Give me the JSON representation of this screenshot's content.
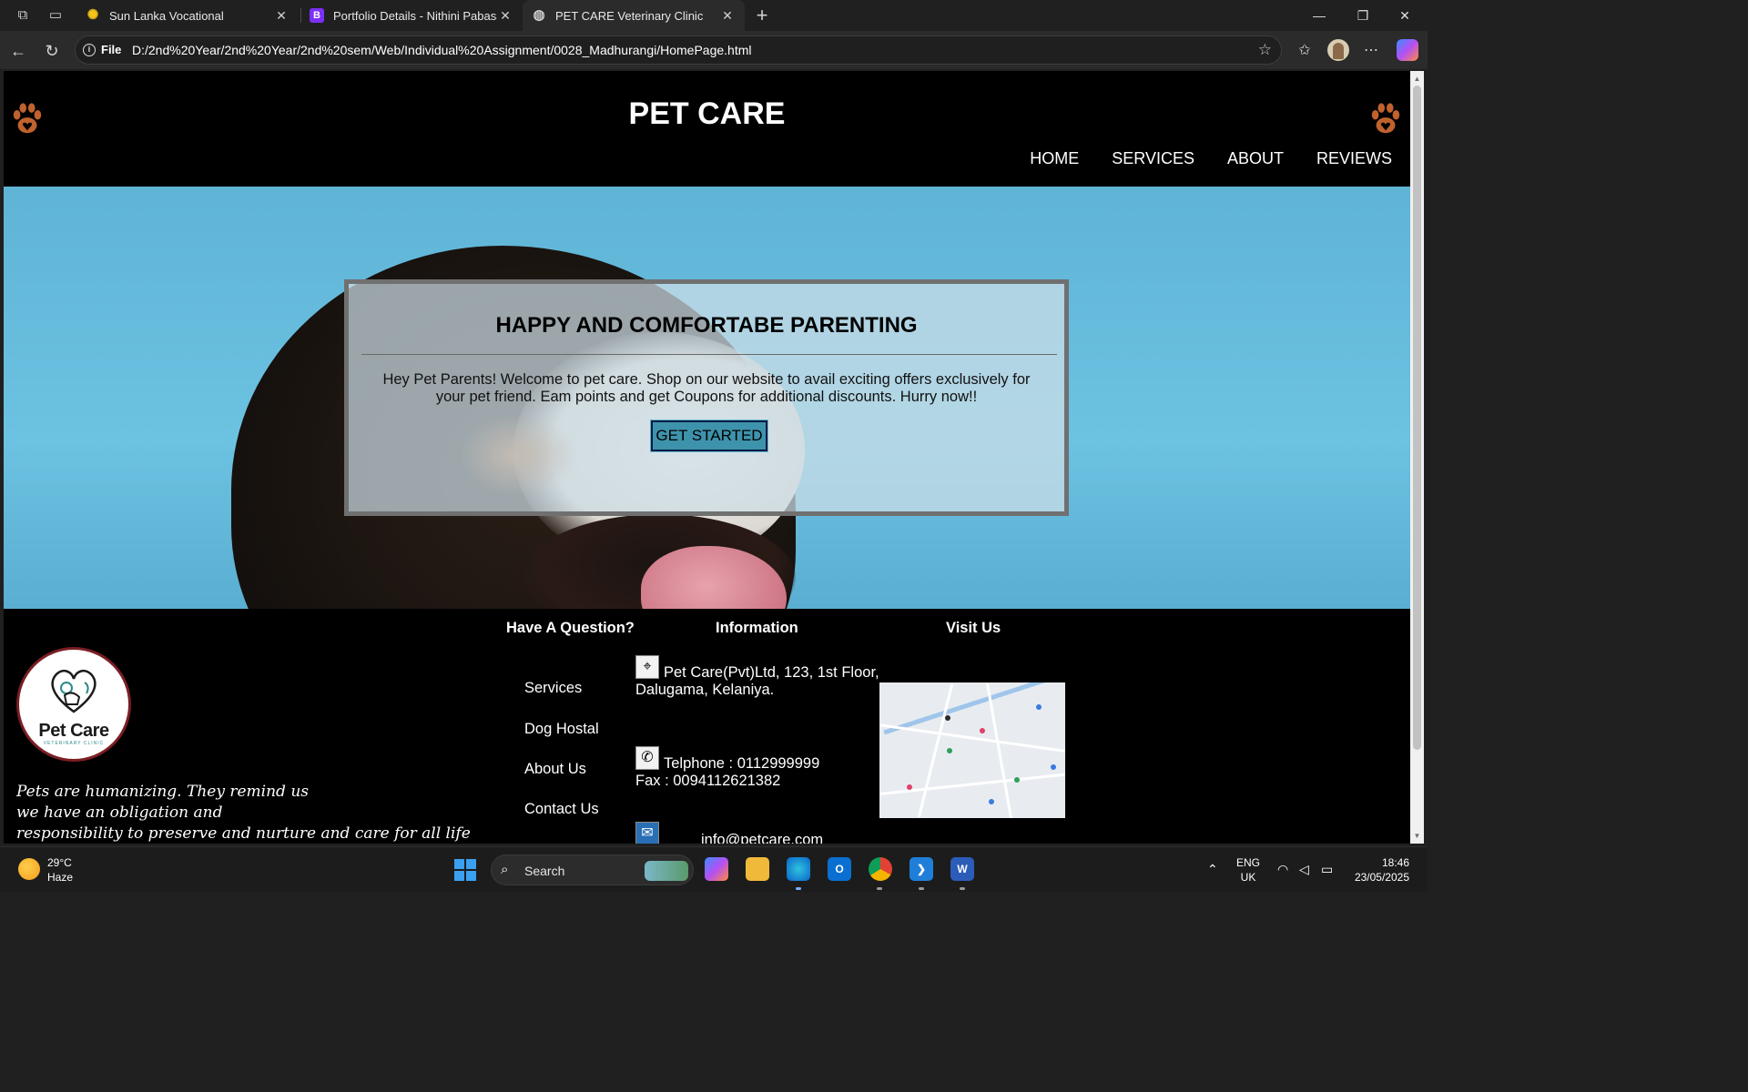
{
  "browser": {
    "tabs": [
      {
        "title": "Sun Lanka Vocational",
        "favicon": "sun-icon",
        "active": false
      },
      {
        "title": "Portfolio Details - Nithini Pabasara",
        "favicon_text": "B",
        "active": false
      },
      {
        "title": "PET CARE Veterinary Clinic",
        "favicon": "globe-icon",
        "active": true
      }
    ],
    "address": {
      "scheme_label": "File",
      "url": "D:/2nd%20Year/2nd%20Year/2nd%20sem/Web/Individual%20Assignment/0028_Madhurangi/HomePage.html"
    }
  },
  "site": {
    "title": "PET CARE",
    "nav": [
      "HOME",
      "SERVICES",
      "ABOUT",
      "REVIEWS"
    ],
    "hero": {
      "heading": "HAPPY AND COMFORTABE PARENTING",
      "text": "Hey Pet Parents! Welcome to pet care. Shop on our website to avail exciting offers exclusively for your pet friend. Eam points and get Coupons for additional discounts. Hurry now!!",
      "button": "GET STARTED"
    },
    "footer": {
      "logo": {
        "name": "Pet Care",
        "tagline": "VETERINARY CLINIC"
      },
      "quote_lines": [
        "Pets are humanizing. They remind us",
        "we have an obligation and",
        "responsibility to preserve and nurture and care for all life"
      ],
      "question_heading": "Have A Question?",
      "links": [
        "Services",
        "Dog Hostal",
        "About Us",
        "Contact Us"
      ],
      "info_heading": "Information",
      "address": "Pet Care(Pvt)Ltd, 123, 1st Floor, Dalugama, Kelaniya.",
      "phone": "Telphone : 0112999999",
      "fax": "Fax : 0094112621382",
      "email": "info@petcare.com",
      "visit_heading": "Visit Us"
    }
  },
  "taskbar": {
    "weather": {
      "temp": "29°C",
      "condition": "Haze"
    },
    "search_label": "Search",
    "language": {
      "lang": "ENG",
      "region": "UK"
    },
    "clock": {
      "time": "18:46",
      "date": "23/05/2025"
    }
  }
}
